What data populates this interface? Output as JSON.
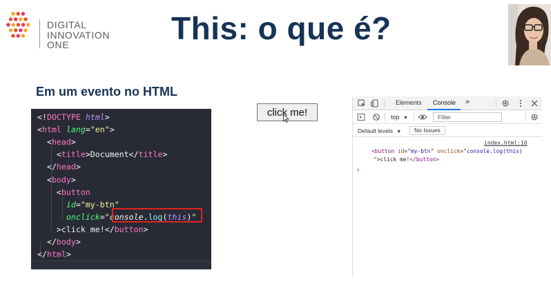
{
  "logo": {
    "line1": "DIGITAL",
    "line2": "INNOVATION",
    "line3": "ONE",
    "accent_colors": [
      "#f5a623",
      "#e8532b",
      "#e8336b"
    ]
  },
  "slide": {
    "title": "This: o que é?",
    "subtitle": "Em um evento no HTML"
  },
  "code_editor": {
    "lines": [
      {
        "parts": [
          [
            "t-punc",
            "<!"
          ],
          [
            "t-tag",
            "DOCTYPE "
          ],
          [
            "t-kw",
            "html"
          ],
          [
            "t-punc",
            ">"
          ]
        ]
      },
      {
        "parts": [
          [
            "t-punc",
            "<"
          ],
          [
            "t-tag",
            "html "
          ],
          [
            "t-attr",
            "lang"
          ],
          [
            "t-punc",
            "="
          ],
          [
            "t-str",
            "\"en\""
          ],
          [
            "t-punc",
            ">"
          ]
        ]
      },
      {
        "parts": [
          [
            "t-punc",
            "  <"
          ],
          [
            "t-tag",
            "head"
          ],
          [
            "t-punc",
            ">"
          ]
        ]
      },
      {
        "parts": [
          [
            "t-punc",
            "    <"
          ],
          [
            "t-tag",
            "title"
          ],
          [
            "t-punc",
            ">Document</"
          ],
          [
            "t-tag",
            "title"
          ],
          [
            "t-punc",
            ">"
          ]
        ]
      },
      {
        "parts": [
          [
            "t-punc",
            "  </"
          ],
          [
            "t-tag",
            "head"
          ],
          [
            "t-punc",
            ">"
          ]
        ]
      },
      {
        "parts": [
          [
            "t-punc",
            "  <"
          ],
          [
            "t-tag",
            "body"
          ],
          [
            "t-punc",
            ">"
          ]
        ]
      },
      {
        "parts": [
          [
            "t-punc",
            "    <"
          ],
          [
            "t-tag",
            "button"
          ]
        ]
      },
      {
        "parts": [
          [
            "t-attr",
            "      id"
          ],
          [
            "t-punc",
            "="
          ],
          [
            "t-str",
            "\"my-btn\""
          ]
        ]
      },
      {
        "parts": [
          [
            "t-attr",
            "      onclick"
          ],
          [
            "t-punc",
            "="
          ],
          [
            "t-str",
            "\""
          ],
          [
            "t-ital",
            "console"
          ],
          [
            "t-punc",
            "."
          ],
          [
            "t-fn",
            "log"
          ],
          [
            "t-punc",
            "("
          ],
          [
            "t-kw",
            "this"
          ],
          [
            "t-punc",
            ")"
          ],
          [
            "t-str",
            "\""
          ]
        ]
      },
      {
        "parts": [
          [
            "t-punc",
            "    >click me!</"
          ],
          [
            "t-tag",
            "button"
          ],
          [
            "t-punc",
            ">"
          ]
        ]
      },
      {
        "parts": [
          [
            "t-punc",
            "  </"
          ],
          [
            "t-tag",
            "body"
          ],
          [
            "t-punc",
            ">"
          ]
        ]
      },
      {
        "parts": [
          [
            "t-punc",
            "</"
          ],
          [
            "t-tag",
            "html"
          ],
          [
            "t-punc",
            ">"
          ]
        ]
      }
    ],
    "highlight_color": "#e2231a"
  },
  "page_button": {
    "label": "click me!"
  },
  "devtools": {
    "tabs": [
      "Elements",
      "Console"
    ],
    "active_tab": "Console",
    "more_tabs": "»",
    "context": "top",
    "filter_placeholder": "Filter",
    "default_levels": "Default levels",
    "issues": "No Issues",
    "log_source": "index.html:10",
    "log_lines": [
      [
        [
          "c-tag",
          "<button "
        ],
        [
          "c-attr",
          "id"
        ],
        [
          "",
          "=\""
        ],
        [
          "c-val",
          "my-btn"
        ],
        [
          "",
          "\" "
        ],
        [
          "c-attr",
          "onclick"
        ],
        [
          "",
          "=\""
        ],
        [
          "c-val",
          "console.log(this)"
        ]
      ],
      [
        [
          "",
          "\">click me!"
        ],
        [
          "c-tag",
          "</button>"
        ]
      ]
    ],
    "prompt": "›",
    "accent_color": "#1a73e8"
  }
}
